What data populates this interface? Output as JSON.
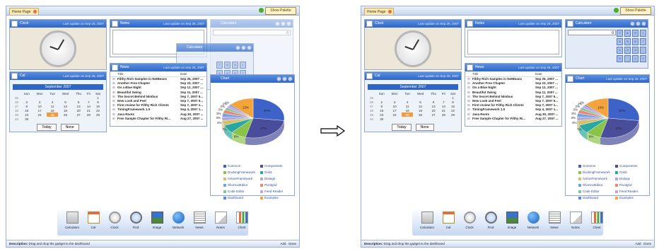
{
  "app": {
    "tab_label": "Home Page",
    "palette_button": "Show Palette"
  },
  "gadgets": {
    "clock": {
      "title": "Clock",
      "update": "Last update on Sep 25, 2007"
    },
    "notes": {
      "title": "Notes",
      "update": "Last update on Sep 25, 2007"
    },
    "calculator": {
      "title": "Calculator",
      "update": "Last update on Sep 25, 2007",
      "display": "0",
      "keys": [
        "7",
        "8",
        "9",
        "/",
        "4",
        "5",
        "6",
        "*",
        "1",
        "2",
        "3",
        "-",
        "0",
        ".",
        "=",
        "+"
      ]
    },
    "cal": {
      "title": "Cal",
      "update": "Last update on Sep 25, 2007",
      "month": "September 2007",
      "weekdays": [
        "Sun",
        "Mon",
        "Tue",
        "Wed",
        "Thu",
        "Fri",
        "Sat"
      ],
      "weeks": [
        {
          "wk": "35",
          "days": [
            "",
            "",
            "",
            "",
            "",
            "",
            "1"
          ]
        },
        {
          "wk": "36",
          "days": [
            "2",
            "3",
            "4",
            "5",
            "6",
            "7",
            "8"
          ]
        },
        {
          "wk": "37",
          "days": [
            "9",
            "10",
            "11",
            "12",
            "13",
            "14",
            "15"
          ]
        },
        {
          "wk": "38",
          "days": [
            "16",
            "17",
            "18",
            "19",
            "20",
            "21",
            "22"
          ]
        },
        {
          "wk": "39",
          "days": [
            "23",
            "24",
            "25",
            "26",
            "27",
            "28",
            "29"
          ]
        },
        {
          "wk": "40",
          "days": [
            "30",
            "",
            "",
            "",
            "",
            "",
            ""
          ]
        }
      ],
      "today": "25",
      "today_button": "Today",
      "none_button": "None"
    },
    "news": {
      "title": "News",
      "update": "Last update on Sep 25, 2007",
      "col_title": "Title",
      "col_date": "Date",
      "items": [
        {
          "title": "Filthy Rich Samples in NetBeans",
          "date": "Sep 25, 2007 ..."
        },
        {
          "title": "Another Free Chapter",
          "date": "Sep 23, 2007 ..."
        },
        {
          "title": "On a Blue Night",
          "date": "Sep 12, 2007 ..."
        },
        {
          "title": "Beautiful Swing",
          "date": "Sep 11, 2007 ..."
        },
        {
          "title": "The Secret Behind Nimbus",
          "date": "Sep 7, 2007 5..."
        },
        {
          "title": "New Look and Feel",
          "date": "Sep 7, 2007 5..."
        },
        {
          "title": "First review for Filthy Rich Clients",
          "date": "Sep 7, 2007 1..."
        },
        {
          "title": "TimingFramework 1.0",
          "date": "Sep 4, 2007 1..."
        },
        {
          "title": "Java Roots",
          "date": "Aug 30, 2007 ..."
        },
        {
          "title": "Free Sample Chapter for Filthy Ri...",
          "date": "Aug 27, 2007 ..."
        }
      ]
    },
    "chart": {
      "title": "Chart",
      "update": "Last update on Sep 25, 2007"
    }
  },
  "chart_data": {
    "type": "pie",
    "title": "",
    "categories": [
      "Common",
      "Components",
      "DockingFramework",
      "Grids",
      "ActionFramework",
      "Dialogs",
      "ShortcutEditor",
      "Pivotgrid",
      "Code Editor",
      "Feed Reader",
      "Dashboard",
      "Examples"
    ],
    "values": [
      27,
      27,
      8,
      7,
      4,
      3,
      3,
      3,
      2,
      2,
      1,
      13
    ],
    "slice_labels": [
      "27%",
      "27%",
      "8%",
      "7%",
      "4%",
      "3%",
      "3%",
      "3%",
      "2%",
      "2%",
      "1%",
      "13%"
    ],
    "colors": [
      "#3d62c8",
      "#4a4e9a",
      "#8bc34a",
      "#2aa7a0",
      "#d2c16a",
      "#b5a6d6",
      "#6fa4e6",
      "#e88a72",
      "#7bc5a4",
      "#c9a0d8",
      "#5d88d9",
      "#f3a43b"
    ],
    "legend_position": "bottom"
  },
  "dock": {
    "items": [
      {
        "label": "Calculator",
        "icon": "calculator-icon"
      },
      {
        "label": "Cal",
        "icon": "calendar-icon"
      },
      {
        "label": "Clock",
        "icon": "clock-icon"
      },
      {
        "label": "Find",
        "icon": "magnifier-icon"
      },
      {
        "label": "Image",
        "icon": "image-icon"
      },
      {
        "label": "Network",
        "icon": "globe-icon"
      },
      {
        "label": "News",
        "icon": "news-icon"
      },
      {
        "label": "Notes",
        "icon": "notes-icon"
      },
      {
        "label": "Chart",
        "icon": "chart-icon"
      }
    ]
  },
  "status": {
    "desc_label": "Description:",
    "desc_text": "Drag and drop the gadget to the dashboard",
    "add": "Add",
    "done": "Done"
  }
}
